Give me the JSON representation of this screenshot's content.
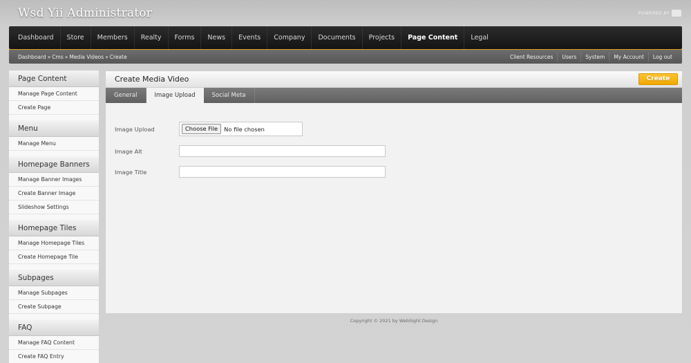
{
  "app": {
    "title": "Wsd Yii Administrator",
    "powered_by": "POWERED BY"
  },
  "main_nav": {
    "items": [
      "Dashboard",
      "Store",
      "Members",
      "Realty",
      "Forms",
      "News",
      "Events",
      "Company",
      "Documents",
      "Projects",
      "Page Content",
      "Legal"
    ],
    "active": "Page Content"
  },
  "breadcrumb": {
    "items": [
      "Dashboard",
      "Cms",
      "Media Videos",
      "Create"
    ],
    "separator": "»"
  },
  "utility_nav": {
    "items": [
      "Client Resources",
      "Users",
      "System",
      "My Account",
      "Log out"
    ]
  },
  "sidebar": {
    "sections": [
      {
        "title": "Page Content",
        "links": [
          "Manage Page Content",
          "Create Page"
        ]
      },
      {
        "title": "Menu",
        "links": [
          "Manage Menu"
        ]
      },
      {
        "title": "Homepage Banners",
        "links": [
          "Manage Banner Images",
          "Create Banner Image",
          "Slideshow Settings"
        ]
      },
      {
        "title": "Homepage Tiles",
        "links": [
          "Manage Homepage Tiles",
          "Create Homepage Tile"
        ]
      },
      {
        "title": "Subpages",
        "links": [
          "Manage Subpages",
          "Create Subpage"
        ]
      },
      {
        "title": "FAQ",
        "links": [
          "Manage FAQ Content",
          "Create FAQ Entry"
        ]
      }
    ]
  },
  "panel": {
    "title": "Create Media Video",
    "create_label": "Create",
    "tabs": [
      "General",
      "Image Upload",
      "Social Meta"
    ],
    "active_tab": "Image Upload",
    "form": {
      "image_upload_label": "Image Upload",
      "choose_file_label": "Choose File",
      "file_status": "No file chosen",
      "image_alt_label": "Image Alt",
      "image_alt_value": "",
      "image_title_label": "Image Title",
      "image_title_value": ""
    }
  },
  "footer": {
    "text": "Copyright © 2021 by WebSight Design"
  },
  "colors": {
    "accent": "#f0a800",
    "nav_bg": "#1e1e1e",
    "subbar_bg": "#606060"
  }
}
